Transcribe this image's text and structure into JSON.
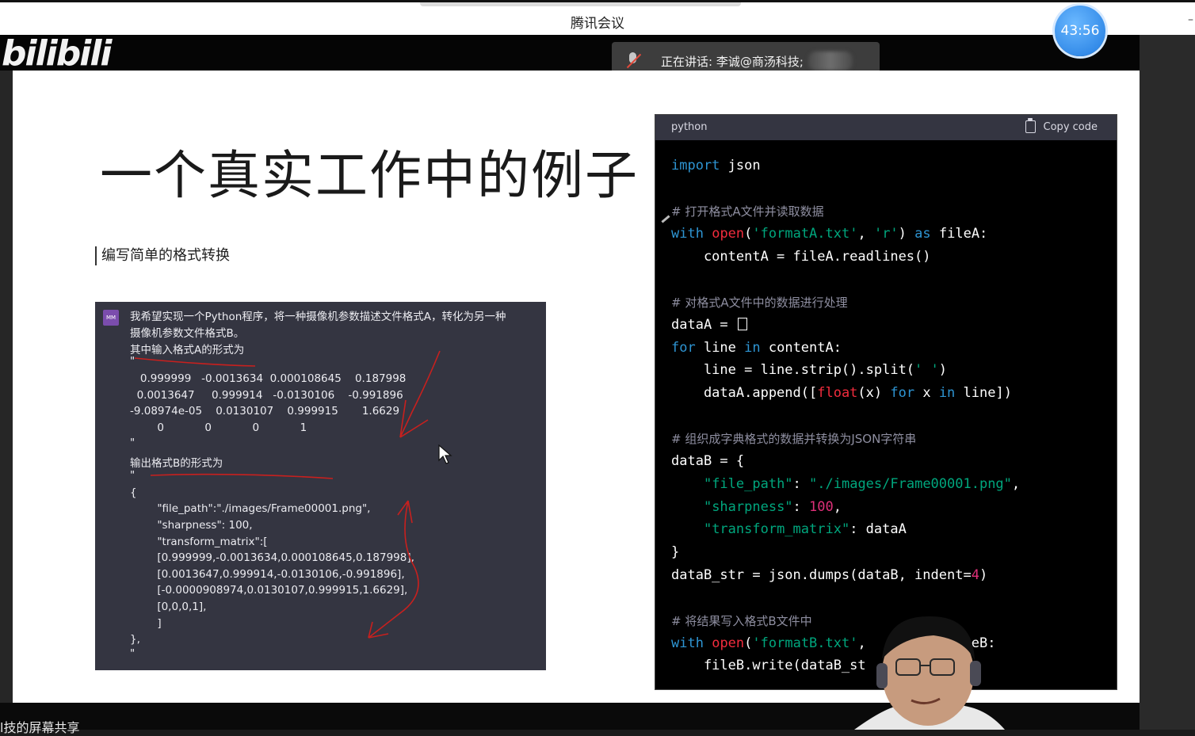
{
  "window": {
    "title": "腾讯会议",
    "timer": "43:56",
    "minimize_glyph": "–"
  },
  "speaking": {
    "label": "正在讲话: 李诚@商汤科技;",
    "icon": "muted-mic-icon"
  },
  "logo": {
    "text": "bilibili"
  },
  "slide": {
    "title": "一个真实工作中的例子",
    "subtitle": "编写简单的格式转换"
  },
  "chat": {
    "avatar": "MM",
    "lines": [
      "我希望实现一个Python程序，将一种摄像机参数描述文件格式A，转化为另一种",
      "摄像机参数文件格式B。",
      "其中输入格式A的形式为",
      "\"",
      "   0.999999   -0.0013634  0.000108645    0.187998",
      "  0.0013647     0.999914   -0.0130106    -0.991896",
      "-9.08974e-05    0.0130107    0.999915       1.6629",
      "        0            0            0            1",
      "\"",
      "输出格式B的形式为",
      "\"",
      "{",
      "        \"file_path\":\"./images/Frame00001.png\",",
      "        \"sharpness\": 100,",
      "        \"transform_matrix\":[",
      "        [0.999999,-0.0013634,0.000108645,0.187998],",
      "        [0.0013647,0.999914,-0.0130106,-0.991896],",
      "        [-0.0000908974,0.0130107,0.999915,1.6629],",
      "        [0,0,0,1],",
      "        ]",
      "},",
      "\""
    ]
  },
  "code_block": {
    "language": "python",
    "copy_label": "Copy code",
    "lines": [
      {
        "parts": [
          {
            "t": "import",
            "c": "kw"
          },
          {
            "t": " json",
            "c": ""
          }
        ]
      },
      {
        "parts": []
      },
      {
        "parts": [
          {
            "t": "# 打开格式A文件并读取数据",
            "c": "cm"
          }
        ]
      },
      {
        "parts": [
          {
            "t": "with",
            "c": "kw"
          },
          {
            "t": " ",
            "c": ""
          },
          {
            "t": "open",
            "c": "fn"
          },
          {
            "t": "(",
            "c": ""
          },
          {
            "t": "'formatA.txt'",
            "c": "st"
          },
          {
            "t": ", ",
            "c": ""
          },
          {
            "t": "'r'",
            "c": "st"
          },
          {
            "t": ") ",
            "c": ""
          },
          {
            "t": "as",
            "c": "kw"
          },
          {
            "t": " fileA:",
            "c": ""
          }
        ]
      },
      {
        "parts": [
          {
            "t": "    contentA = fileA.readlines()",
            "c": ""
          }
        ]
      },
      {
        "parts": []
      },
      {
        "parts": [
          {
            "t": "# 对格式A文件中的数据进行处理",
            "c": "cm"
          }
        ]
      },
      {
        "parts": [
          {
            "t": "dataA = ",
            "c": ""
          },
          {
            "t": "[]",
            "c": "box"
          }
        ]
      },
      {
        "parts": [
          {
            "t": "for",
            "c": "kw"
          },
          {
            "t": " line ",
            "c": ""
          },
          {
            "t": "in",
            "c": "kw"
          },
          {
            "t": " contentA:",
            "c": ""
          }
        ]
      },
      {
        "parts": [
          {
            "t": "    line = line.strip().split(",
            "c": ""
          },
          {
            "t": "' '",
            "c": "st"
          },
          {
            "t": ")",
            "c": ""
          }
        ]
      },
      {
        "parts": [
          {
            "t": "    dataA.append([",
            "c": ""
          },
          {
            "t": "float",
            "c": "fn"
          },
          {
            "t": "(x) ",
            "c": ""
          },
          {
            "t": "for",
            "c": "kw"
          },
          {
            "t": " x ",
            "c": ""
          },
          {
            "t": "in",
            "c": "kw"
          },
          {
            "t": " line])",
            "c": ""
          }
        ]
      },
      {
        "parts": []
      },
      {
        "parts": [
          {
            "t": "# 组织成字典格式的数据并转换为JSON字符串",
            "c": "cm"
          }
        ]
      },
      {
        "parts": [
          {
            "t": "dataB = {",
            "c": ""
          }
        ]
      },
      {
        "parts": [
          {
            "t": "    ",
            "c": ""
          },
          {
            "t": "\"file_path\"",
            "c": "st"
          },
          {
            "t": ": ",
            "c": ""
          },
          {
            "t": "\"./images/Frame00001.png\"",
            "c": "st"
          },
          {
            "t": ",",
            "c": ""
          }
        ]
      },
      {
        "parts": [
          {
            "t": "    ",
            "c": ""
          },
          {
            "t": "\"sharpness\"",
            "c": "st"
          },
          {
            "t": ": ",
            "c": ""
          },
          {
            "t": "100",
            "c": "nm"
          },
          {
            "t": ",",
            "c": ""
          }
        ]
      },
      {
        "parts": [
          {
            "t": "    ",
            "c": ""
          },
          {
            "t": "\"transform_matrix\"",
            "c": "st"
          },
          {
            "t": ": dataA",
            "c": ""
          }
        ]
      },
      {
        "parts": [
          {
            "t": "}",
            "c": ""
          }
        ]
      },
      {
        "parts": [
          {
            "t": "dataB_str = json.dumps(dataB, indent=",
            "c": ""
          },
          {
            "t": "4",
            "c": "nm"
          },
          {
            "t": ")",
            "c": ""
          }
        ]
      },
      {
        "parts": []
      },
      {
        "parts": [
          {
            "t": "# 将结果写入格式B文件中",
            "c": "cm"
          }
        ]
      },
      {
        "parts": [
          {
            "t": "with",
            "c": "kw"
          },
          {
            "t": " ",
            "c": ""
          },
          {
            "t": "open",
            "c": "fn"
          },
          {
            "t": "(",
            "c": ""
          },
          {
            "t": "'formatB.txt'",
            "c": "st"
          },
          {
            "t": ",          fileB:",
            "c": ""
          }
        ]
      },
      {
        "parts": [
          {
            "t": "    fileB.write(dataB_st",
            "c": ""
          }
        ]
      }
    ]
  },
  "bottom": {
    "share_label": "l技的屏幕共享"
  },
  "colors": {
    "keyword": "#2e95d3",
    "function": "#f22c3d",
    "string": "#00a67d",
    "number": "#df3079",
    "comment": "#8e8ea0",
    "annotation_ink": "#c8201e",
    "timer_blue": "#1f7ae0"
  }
}
